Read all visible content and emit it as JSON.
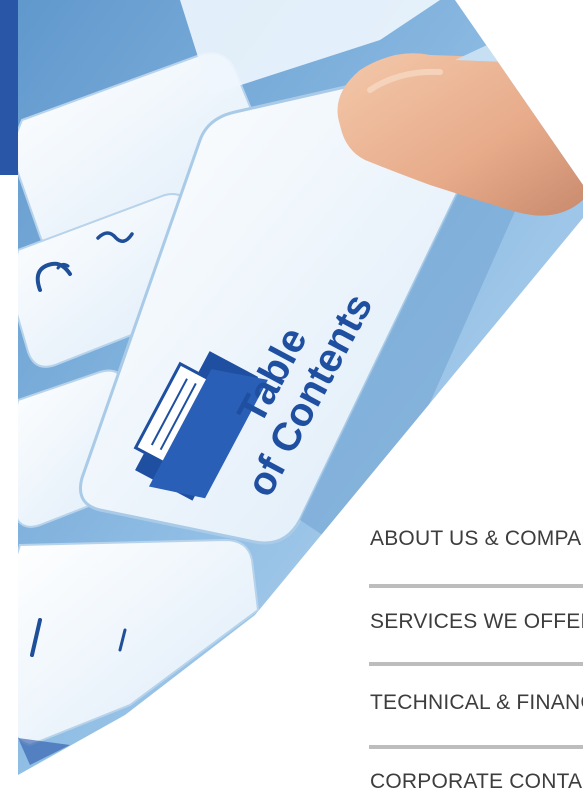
{
  "key_label_line1": "Table",
  "key_label_line2": "of Contents",
  "toc_items": [
    "ABOUT US & COMPANY",
    "SERVICES WE OFFER",
    "TECHNICAL & FINANCIAL",
    "CORPORATE CONTACTS"
  ],
  "colors": {
    "brand_blue": "#2a56a8",
    "key_blue": "#1e4fa0",
    "keyboard_light": "#dbe9f6",
    "text": "#3d3d3d",
    "rule": "#bdbdbd"
  }
}
